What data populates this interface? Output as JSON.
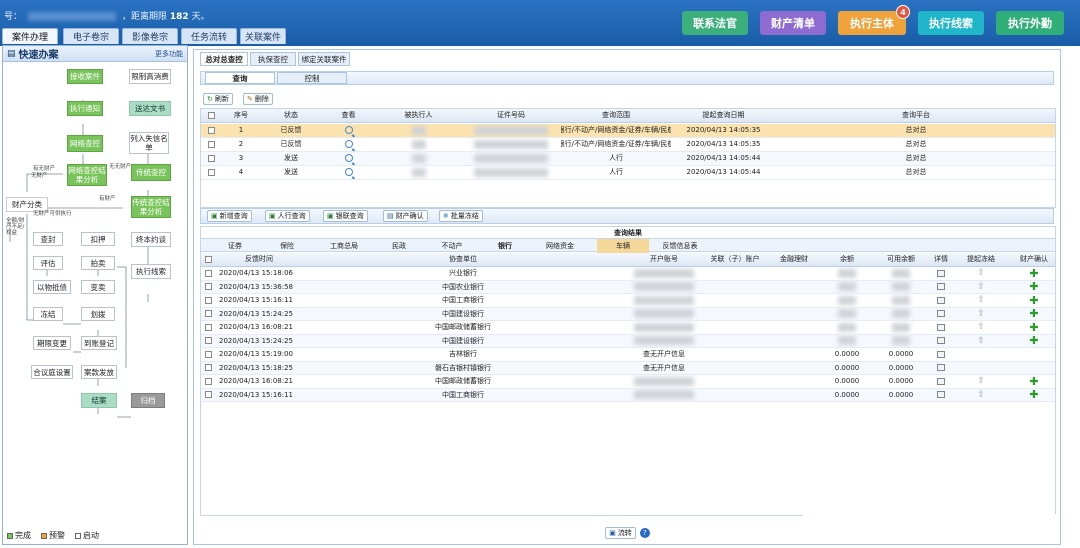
{
  "topbar": {
    "prefix": "号：",
    "middle": "，距离期限",
    "days": "182",
    "suffix": "天。",
    "buttons": [
      {
        "label": "联系法官",
        "color": "#3bb07d"
      },
      {
        "label": "财产清单",
        "color": "#8e6bd1"
      },
      {
        "label": "执行主体",
        "color": "#f0a23b",
        "badge": "4"
      },
      {
        "label": "执行线索",
        "color": "#1fb6c9"
      },
      {
        "label": "执行外勤",
        "color": "#2fae79"
      }
    ]
  },
  "nav_tabs": [
    "案件办理",
    "电子卷宗",
    "影像卷宗",
    "任务流转",
    "关联案件"
  ],
  "left": {
    "title": "快速办案",
    "more": "更多功能",
    "nodes": {
      "jieshou": "接收案件",
      "xianzhi": "限制高消费",
      "tongzhi": "执行通知",
      "songda": "送达文书",
      "wangluo": "网络查控",
      "shixin": "列入失信名单",
      "fenxi": "网络查控结果分析",
      "chuantong": "传统查控",
      "chuantong_fx": "传统查控结果分析",
      "caichan": "财产分类",
      "chafeng": "查封",
      "koya": "扣押",
      "pinggu": "评估",
      "paimai": "拍卖",
      "yiwu": "以物抵债",
      "biangmai": "变卖",
      "zhongben": "终本约谈",
      "xiansuo": "执行线索",
      "dongjie": "冻结",
      "huabo": "划拨",
      "qixian": "期限变更",
      "daozhang": "到账登记",
      "hejian": "合议庭设置",
      "kuanxiang": "案款发放",
      "jiean": "结案",
      "guidang": "归档"
    },
    "edge_labels": [
      "有无财产",
      "有财产",
      "无无财产",
      "无财产",
      "无财产可供执行",
      "全额/财产不足/权益"
    ],
    "legend": [
      "完成",
      "预警",
      "启动"
    ]
  },
  "main": {
    "tabs": [
      "总对总查控",
      "执保查控",
      "绑定关联案件"
    ],
    "inner_tabs": [
      "查询",
      "控制"
    ],
    "toolbar": {
      "refresh": "刷新",
      "delete": "删除"
    },
    "query_headers": [
      "序号",
      "状态",
      "查看",
      "被执行人",
      "证件号码",
      "查询范围",
      "提起查询日期",
      "查询平台"
    ],
    "query_rows": [
      {
        "seq": "1",
        "status": "已反馈",
        "scope": "银行/不动产/网络资金/证券/车辆/民航",
        "date": "2020/04/13 14:05:35",
        "platform": "总对总"
      },
      {
        "seq": "2",
        "status": "已反馈",
        "scope": "银行/不动产/网络资金/证券/车辆/民航",
        "date": "2020/04/13 14:05:35",
        "platform": "总对总"
      },
      {
        "seq": "3",
        "status": "发送",
        "scope": "人行",
        "date": "2020/04/13 14:05:44",
        "platform": "总对总"
      },
      {
        "seq": "4",
        "status": "发送",
        "scope": "人行",
        "date": "2020/04/13 14:05:44",
        "platform": "总对总"
      }
    ],
    "action_buttons": [
      "新增查询",
      "人行查询",
      "银联查询",
      "财产确认",
      "批量冻结"
    ],
    "result_title": "查询结果",
    "categories": [
      "证券",
      "保险",
      "工商总局",
      "民政",
      "不动产",
      "银行",
      "网络资金",
      "车辆",
      "反馈信息表"
    ],
    "active_category": "车辆",
    "result_headers": [
      "反馈时间",
      "协查单位",
      "开户账号",
      "关联（子）账户",
      "金融理财",
      "余额",
      "可用余额",
      "详情",
      "提起冻结",
      "财产确认"
    ],
    "result_rows": [
      {
        "time": "2020/04/13 15:18:06",
        "unit": "兴业银行",
        "account": "",
        "bal": "",
        "avail": "",
        "up": true,
        "plus": true
      },
      {
        "time": "2020/04/13 15:36:58",
        "unit": "中国农业银行",
        "account": "",
        "bal": "",
        "avail": "",
        "up": true,
        "plus": true
      },
      {
        "time": "2020/04/13 15:16:11",
        "unit": "中国工商银行",
        "account": "",
        "bal": "",
        "avail": "",
        "up": true,
        "plus": true
      },
      {
        "time": "2020/04/13 15:24:25",
        "unit": "中国建设银行",
        "account": "",
        "bal": "",
        "avail": "",
        "up": true,
        "plus": true
      },
      {
        "time": "2020/04/13 16:08:21",
        "unit": "中国邮政储蓄银行",
        "account": "",
        "bal": "",
        "avail": "",
        "up": true,
        "plus": true
      },
      {
        "time": "2020/04/13 15:24:25",
        "unit": "中国建设银行",
        "account": "",
        "bal": "",
        "avail": "",
        "up": true,
        "plus": true
      },
      {
        "time": "2020/04/13 15:19:00",
        "unit": "吉林银行",
        "account": "查无开户信息",
        "bal": "0.0000",
        "avail": "0.0000",
        "up": false,
        "plus": false
      },
      {
        "time": "2020/04/13 15:18:25",
        "unit": "磐石吉银村镇银行",
        "account": "查无开户信息",
        "bal": "0.0000",
        "avail": "0.0000",
        "up": false,
        "plus": false
      },
      {
        "time": "2020/04/13 16:08:21",
        "unit": "中国邮政储蓄银行",
        "account": "",
        "bal": "0.0000",
        "avail": "0.0000",
        "up": true,
        "plus": true
      },
      {
        "time": "2020/04/13 15:16:11",
        "unit": "中国工商银行",
        "account": "",
        "bal": "0.0000",
        "avail": "0.0000",
        "up": true,
        "plus": true
      }
    ],
    "footer_button": "流转"
  }
}
